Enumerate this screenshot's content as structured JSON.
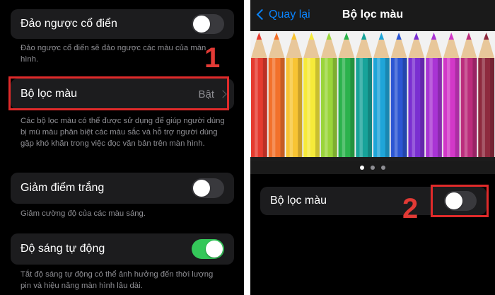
{
  "left": {
    "classic_invert": {
      "label": "Đảo ngược cổ điển",
      "enabled": false,
      "footnote": "Đảo ngược cổ điển sẽ đảo ngược các màu của màn hình."
    },
    "color_filters": {
      "label": "Bộ lọc màu",
      "value": "Bật",
      "footnote": "Các bộ lọc màu có thể được sử dụng để giúp người dùng bị mù màu phân biệt các màu sắc và hỗ trợ người dùng gặp khó khăn trong việc đọc văn bản trên màn hình."
    },
    "reduce_white_point": {
      "label": "Giảm điểm trắng",
      "enabled": false,
      "footnote": "Giảm cường độ của các màu sáng."
    },
    "auto_brightness": {
      "label": "Độ sáng tự động",
      "enabled": true,
      "footnote": "Tắt độ sáng tự động có thể ảnh hưởng đến thời lượng pin và hiệu năng màn hình lâu dài."
    }
  },
  "right": {
    "back_label": "Quay lại",
    "title": "Bộ lọc màu",
    "pencil_colors": [
      "#e53a2e",
      "#f2712b",
      "#f8c433",
      "#f6ea3a",
      "#9ad53a",
      "#2bb24c",
      "#17a39a",
      "#1fa5d8",
      "#2b56d3",
      "#7a2fd1",
      "#a934d4",
      "#d238c8",
      "#bb2d7c",
      "#8e2a3e"
    ],
    "page_dots": 3,
    "active_page": 0,
    "color_filter_toggle": {
      "label": "Bộ lọc màu",
      "enabled": false
    }
  },
  "annotations": {
    "marker_1": "1",
    "marker_2": "2",
    "highlight_color": "#e02a2a"
  },
  "colors": {
    "accent": "#0a84ff",
    "toggle_on": "#34c759",
    "toggle_off": "#39393d",
    "cell_background": "#1c1c1e",
    "secondary_text": "#8e8e93"
  }
}
